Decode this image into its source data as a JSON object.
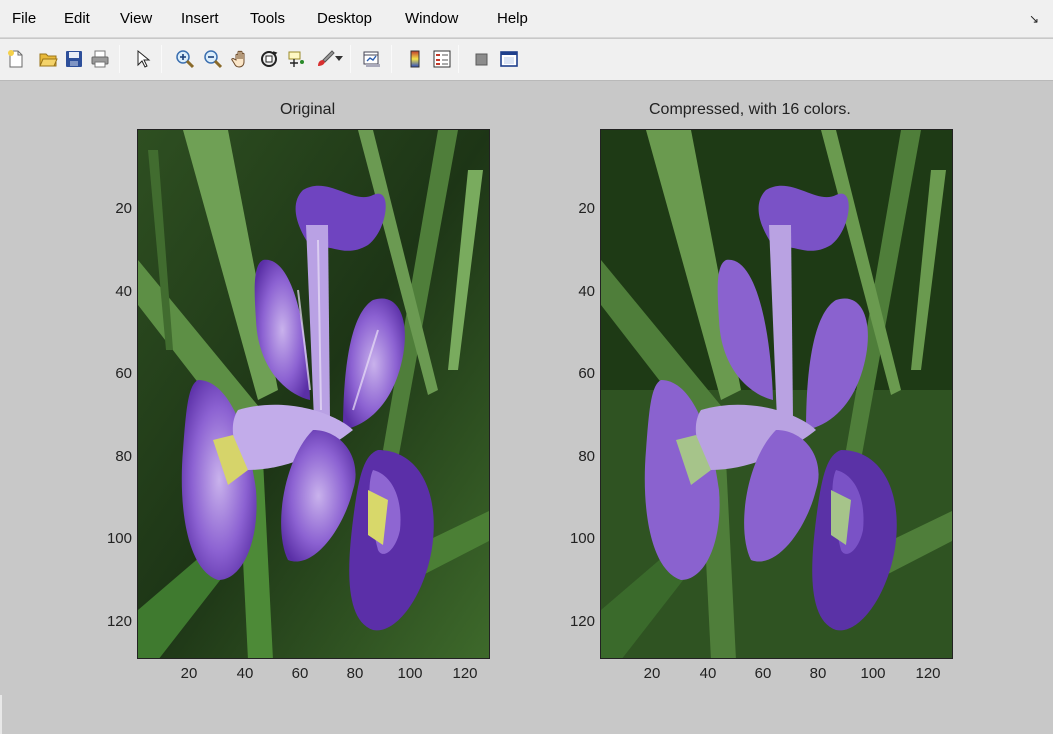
{
  "menubar": {
    "items": [
      "File",
      "Edit",
      "View",
      "Insert",
      "Tools",
      "Desktop",
      "Window",
      "Help"
    ],
    "dock_glyph": "↘"
  },
  "toolbar": {
    "buttons": [
      "new-figure-icon",
      "open-file-icon",
      "save-figure-icon",
      "print-figure-icon",
      "edit-plot-icon",
      "zoom-in-icon",
      "zoom-out-icon",
      "pan-icon",
      "rotate-3d-icon",
      "data-cursor-icon",
      "brush-icon",
      "brush-dropdown-icon",
      "link-plot-icon",
      "insert-colorbar-icon",
      "insert-legend-icon",
      "hide-plot-tools-icon",
      "show-plot-tools-icon"
    ]
  },
  "figure": {
    "axes": [
      {
        "title": "Original",
        "image": "iris-flower-original",
        "xticks": [
          "20",
          "40",
          "60",
          "80",
          "100",
          "120"
        ],
        "yticks": [
          "20",
          "40",
          "60",
          "80",
          "100",
          "120"
        ]
      },
      {
        "title": "Compressed, with 16 colors.",
        "image": "iris-flower-compressed-16-colors",
        "xticks": [
          "20",
          "40",
          "60",
          "80",
          "100",
          "120"
        ],
        "yticks": [
          "20",
          "40",
          "60",
          "80",
          "100",
          "120"
        ]
      }
    ]
  },
  "colors": {
    "figure_bg": "#c8c8c8",
    "grass_dark": "#1f3a16",
    "grass_mid": "#3f6b2c",
    "grass_light": "#7aa85a",
    "petal_dark": "#5b2fa8",
    "petal_mid": "#8a5fd0",
    "petal_light": "#c6b0ea",
    "center_yellow": "#d8d86a"
  }
}
